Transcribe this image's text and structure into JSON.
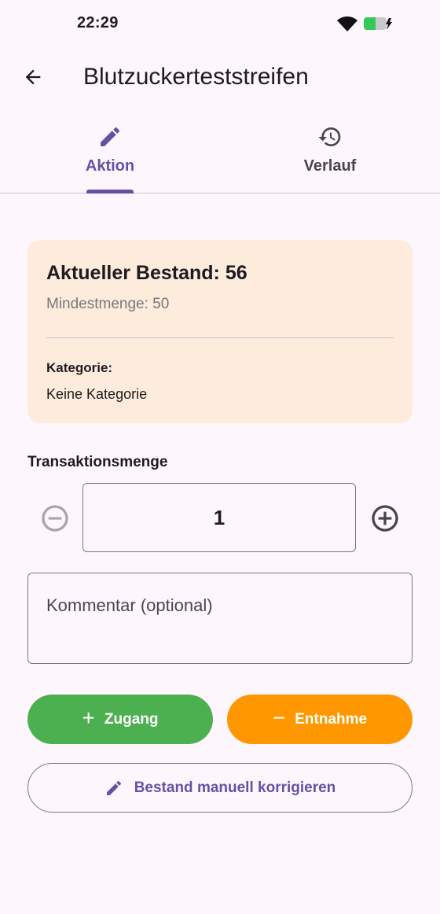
{
  "status_bar": {
    "time": "22:29"
  },
  "app_bar": {
    "title": "Blutzuckerteststreifen"
  },
  "tabs": [
    {
      "label": "Aktion",
      "icon": "pencil-icon",
      "selected": true
    },
    {
      "label": "Verlauf",
      "icon": "history-icon",
      "selected": false
    }
  ],
  "stock_card": {
    "current_stock": "Aktueller Bestand: 56",
    "min_quantity": "Mindestmenge: 50",
    "category_label": "Kategorie:",
    "category_value": "Keine Kategorie"
  },
  "transaction": {
    "label": "Transaktionsmenge",
    "quantity": "1",
    "comment_placeholder": "Kommentar (optional)"
  },
  "actions": {
    "add_label": "Zugang",
    "remove_label": "Entnahme",
    "correct_label": "Bestand manuell korrigieren"
  },
  "colors": {
    "accent": "#6750a4",
    "card_bg": "#fdebdc",
    "add_button": "#4caf50",
    "remove_button": "#ff9800",
    "background": "#fdf7fd"
  }
}
